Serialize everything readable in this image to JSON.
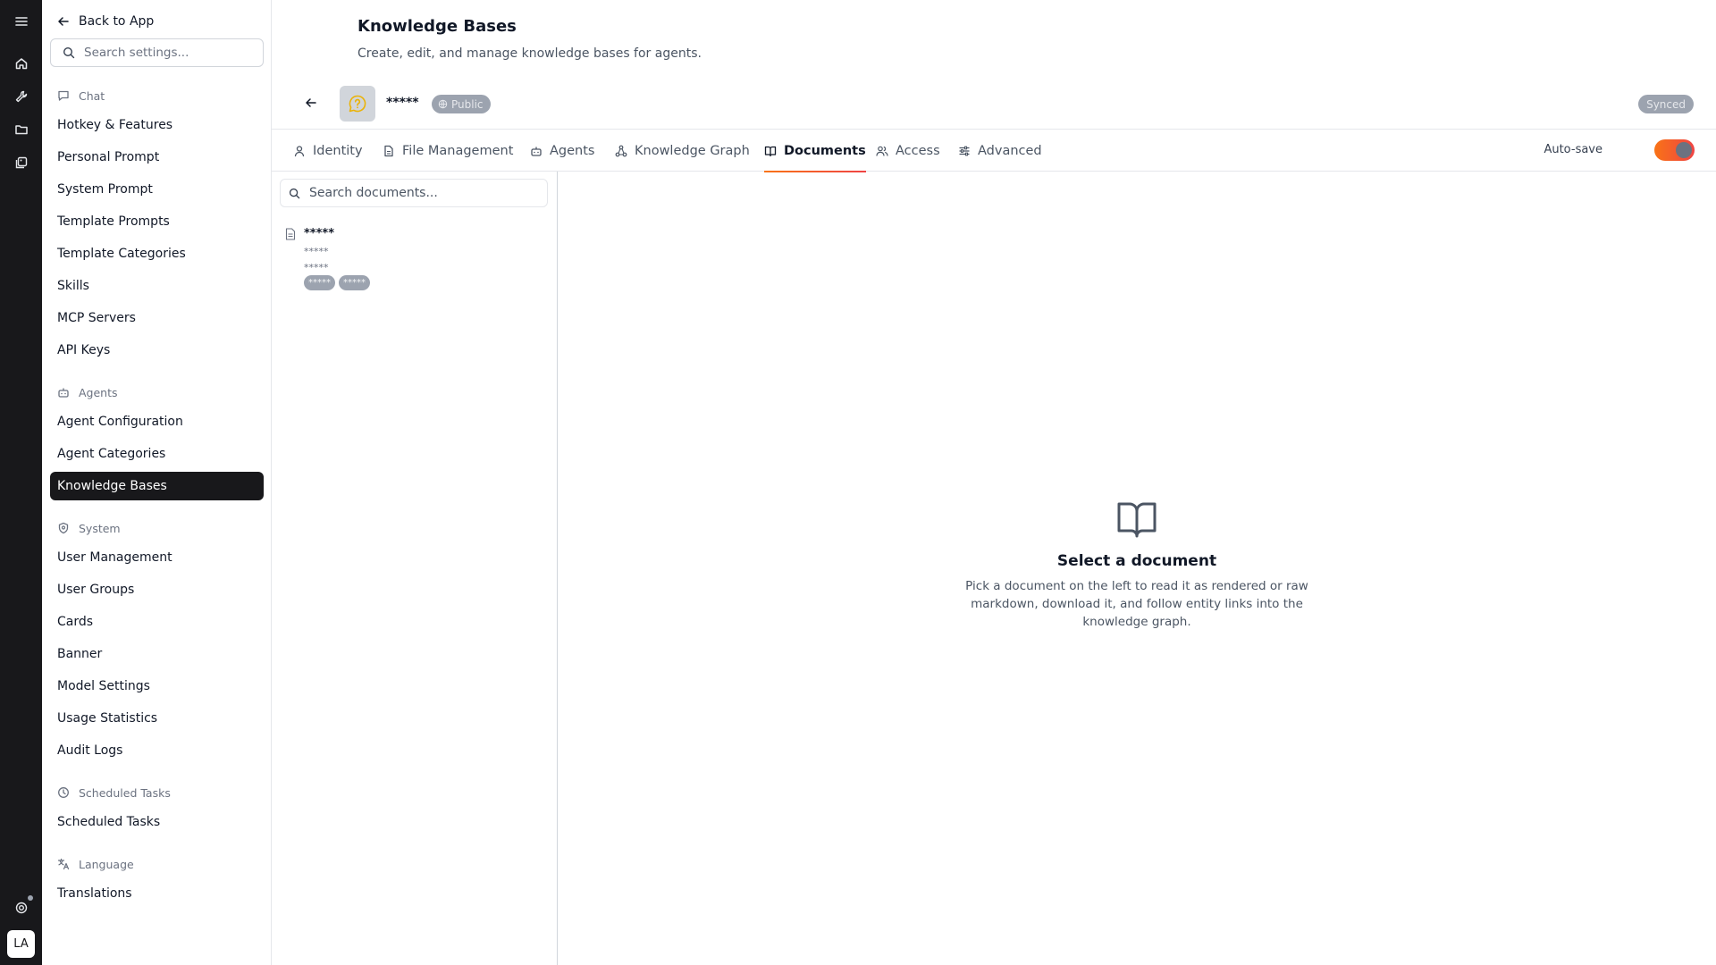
{
  "rail": {
    "avatar_initials": "LA",
    "icons": [
      "menu-icon",
      "home-icon",
      "tools-icon",
      "folder-icon",
      "gallery-icon",
      "support-icon"
    ]
  },
  "sidebar": {
    "back_label": "Back to App",
    "search_placeholder": "Search settings...",
    "sections": {
      "chat": {
        "label": "Chat",
        "items": [
          "Hotkey & Features",
          "Personal Prompt",
          "System Prompt",
          "Template Prompts",
          "Template Categories",
          "Skills",
          "MCP Servers",
          "API Keys"
        ]
      },
      "agents": {
        "label": "Agents",
        "items": [
          "Agent Configuration",
          "Agent Categories",
          "Knowledge Bases"
        ]
      },
      "system": {
        "label": "System",
        "items": [
          "User Management",
          "User Groups",
          "Cards",
          "Banner",
          "Model Settings",
          "Usage Statistics",
          "Audit Logs"
        ]
      },
      "scheduled": {
        "label": "Scheduled Tasks",
        "items": [
          "Scheduled Tasks"
        ]
      },
      "language": {
        "label": "Language",
        "items": [
          "Translations"
        ]
      }
    },
    "active_item": "Knowledge Bases"
  },
  "header": {
    "title": "Knowledge Bases",
    "subtitle": "Create, edit, and manage knowledge bases for agents."
  },
  "kb": {
    "name": "*****",
    "visibility": "Public",
    "status": "Synced"
  },
  "tabs": [
    {
      "label": "Identity",
      "icon": "user-icon"
    },
    {
      "label": "File Management",
      "icon": "file-icon"
    },
    {
      "label": "Agents",
      "icon": "bot-icon"
    },
    {
      "label": "Knowledge Graph",
      "icon": "graph-icon"
    },
    {
      "label": "Documents",
      "icon": "book-icon"
    },
    {
      "label": "Access",
      "icon": "users-icon"
    },
    {
      "label": "Advanced",
      "icon": "sliders-icon"
    }
  ],
  "active_tab": "Documents",
  "autosave": {
    "label": "Auto-save",
    "enabled": true
  },
  "documents": {
    "search_placeholder": "Search documents...",
    "items": [
      {
        "title": "*****",
        "line1": "*****",
        "line2": "*****",
        "tags": [
          "*****",
          "*****"
        ]
      }
    ]
  },
  "empty_state": {
    "title": "Select a document",
    "text": "Pick a document on the left to read it as rendered or raw markdown, download it, and follow entity links into the knowledge graph."
  },
  "colors": {
    "rail_bg": "#18181b",
    "active_nav_bg": "#18181b",
    "accent_start": "#f97316",
    "accent_end": "#ef4444",
    "badge_bg": "#9ca3af"
  }
}
